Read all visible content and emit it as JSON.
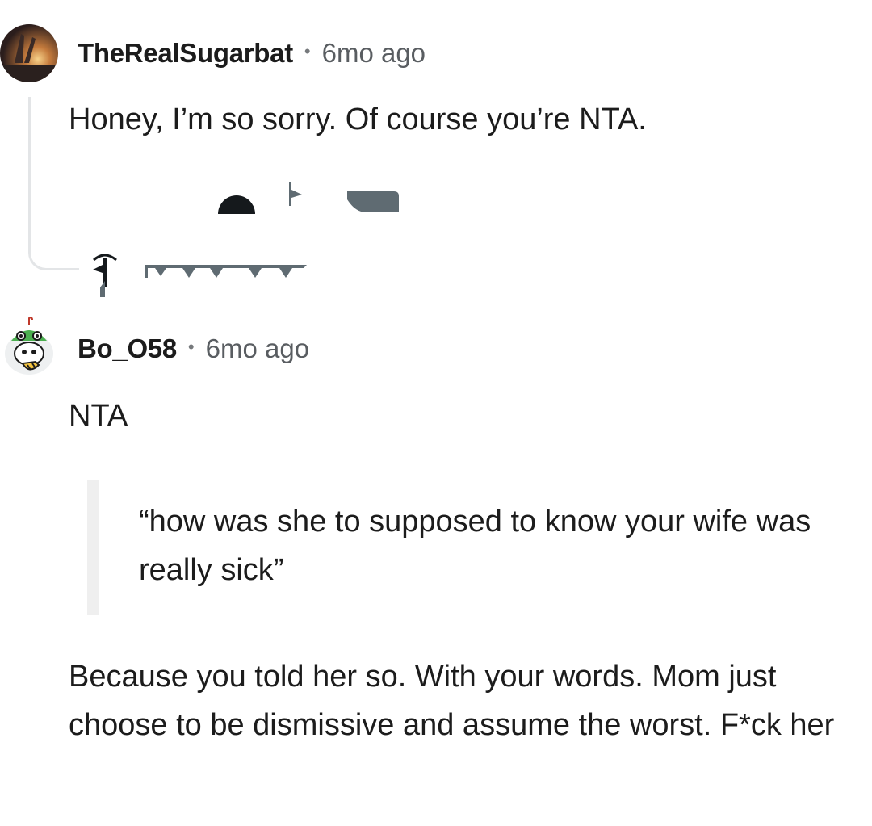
{
  "comments": [
    {
      "username": "TheRealSugarbat",
      "separator": "•",
      "time": "6mo ago",
      "body": "Honey, I’m so sorry. Of course you’re NTA.",
      "avatar_icon": "sunset-avatar-icon"
    },
    {
      "username": "Bo_O58",
      "separator": "•",
      "time": "6mo ago",
      "body_intro": "NTA",
      "quote": "“how was she to supposed to know your wife was really sick”",
      "body_outro": "Because you told her so. With your words. Mom just choose to be dismissive and assume the worst. F*ck her",
      "avatar_icon": "snoo-frog-hat-avatar-icon"
    }
  ],
  "colors": {
    "text": "#1c1c1c",
    "meta": "#595d61",
    "thread_line": "#e3e5e7",
    "quote_bar": "#efefef",
    "artifact_dark": "#15191c",
    "artifact_gray": "#5f6b72"
  }
}
